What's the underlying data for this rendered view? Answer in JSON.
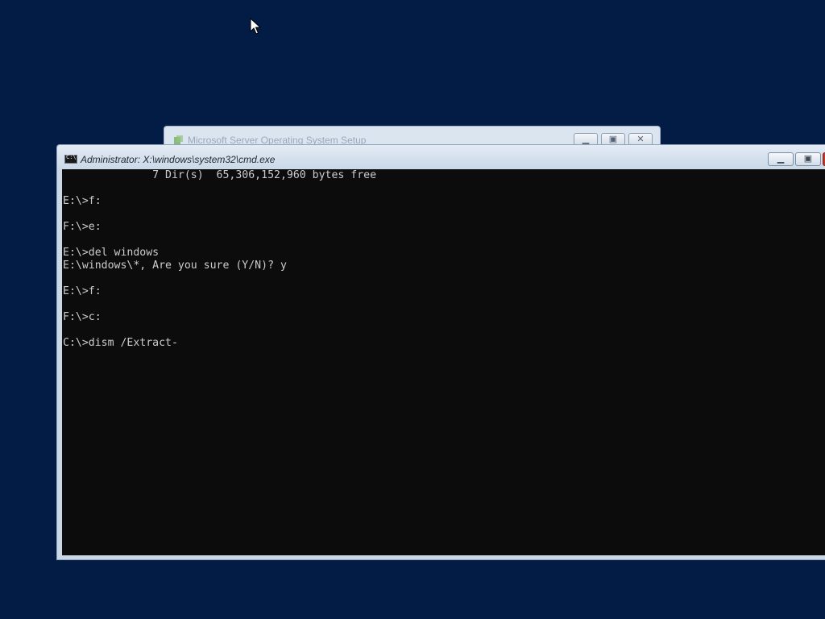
{
  "setup_window": {
    "title": "Microsoft Server Operating System Setup",
    "buttons": {
      "minimize": "▁",
      "restore": "▣",
      "close": "✕"
    }
  },
  "cmd_window": {
    "title": "Administrator: X:\\windows\\system32\\cmd.exe",
    "buttons": {
      "minimize": "▁",
      "restore": "▣"
    },
    "lines": [
      "              7 Dir(s)  65,306,152,960 bytes free",
      "",
      "E:\\>f:",
      "",
      "F:\\>e:",
      "",
      "E:\\>del windows",
      "E:\\windows\\*, Are you sure (Y/N)? y",
      "",
      "E:\\>f:",
      "",
      "F:\\>c:",
      "",
      "C:\\>dism /Extract-"
    ]
  },
  "colors": {
    "desktop": "#021c45",
    "console_bg": "#0c0c0c",
    "console_fg": "#cccccc"
  }
}
